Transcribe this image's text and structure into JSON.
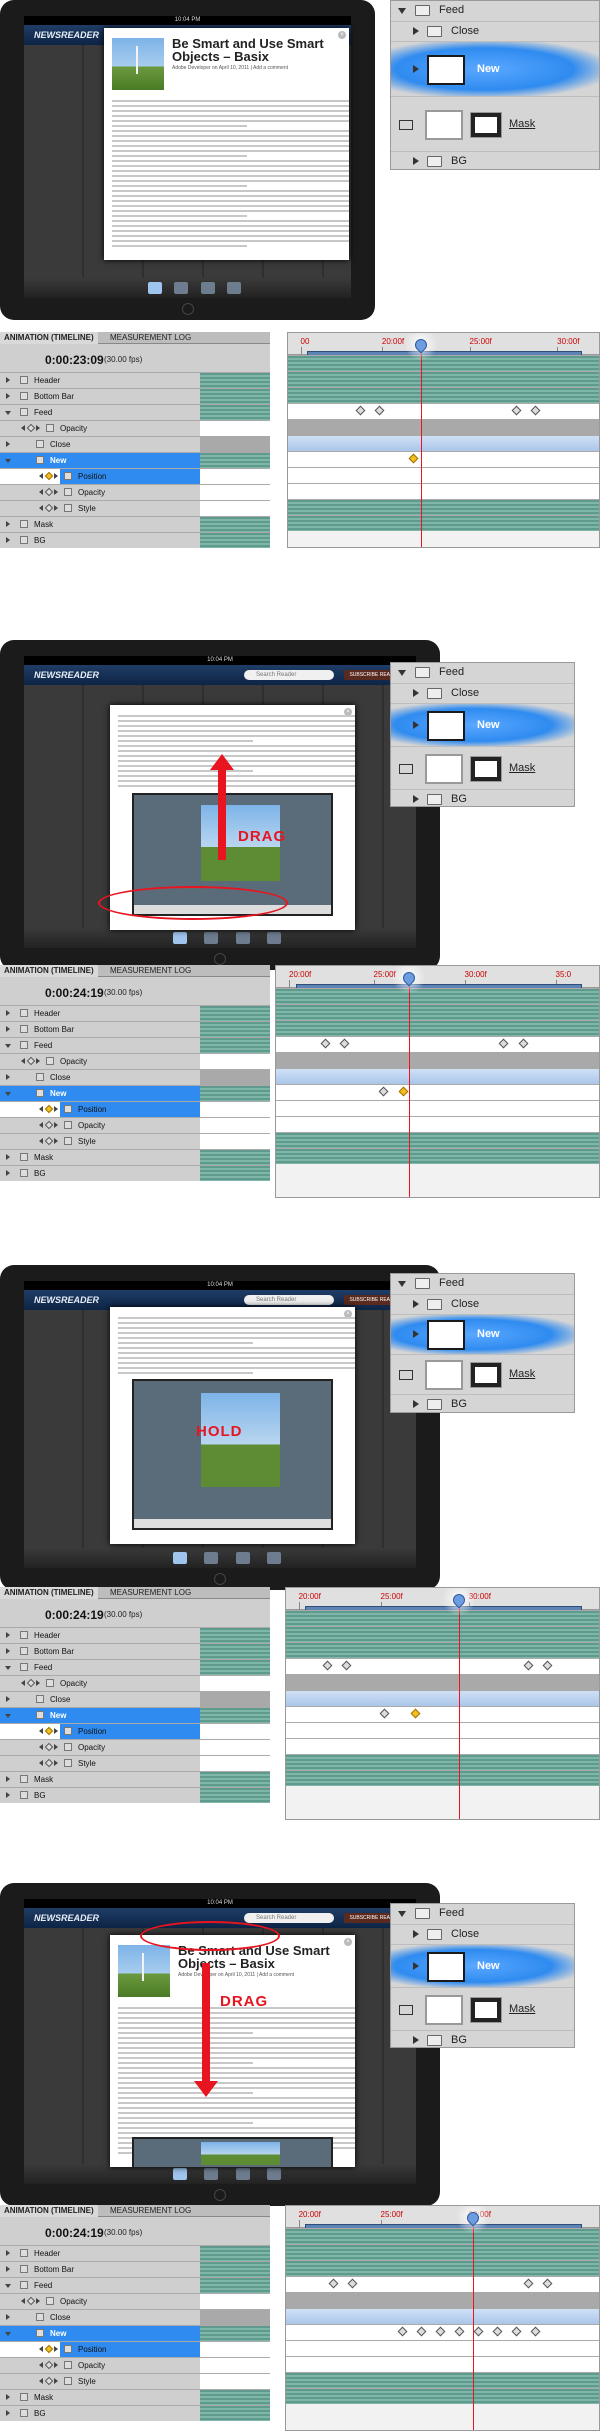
{
  "app": {
    "device_status_left": "iPad",
    "device_time": "10:04 PM",
    "app_name": "NEWSREADER",
    "search_placeholder": "Search Reader",
    "subscribe_label": "SUBSCRIBE READER"
  },
  "article": {
    "title_line1": "Be Smart and Use Smart",
    "title_line2": "Objects – Basix",
    "meta": "Adobe Developer on April 10, 2011 | Add a comment"
  },
  "layers_panel": {
    "group_name": "Feed",
    "items": [
      "Close",
      "New",
      "Mask",
      "BG"
    ]
  },
  "timeline": {
    "tab_animation": "ANIMATION (TIMELINE)",
    "tab_measurement": "MEASUREMENT LOG",
    "fps": "(30.00 fps)",
    "layers": [
      "Header",
      "Bottom Bar",
      "Feed",
      "Opacity",
      "Close",
      "New",
      "Position",
      "Opacity",
      "Style",
      "Mask",
      "BG"
    ]
  },
  "steps": [
    {
      "timecode": "0:00:23:09",
      "ticks": [
        "00",
        "20:00f",
        "25:00f",
        "30:00f"
      ],
      "annotation": ""
    },
    {
      "timecode": "0:00:24:19",
      "ticks": [
        "20:00f",
        "25:00f",
        "30:00f",
        "35:0"
      ],
      "annotation": "DRAG"
    },
    {
      "timecode": "0:00:24:19",
      "ticks": [
        "20:00f",
        "25:00f",
        "30:00f"
      ],
      "annotation": "HOLD"
    },
    {
      "timecode": "0:00:24:19",
      "ticks": [
        "20:00f",
        "25:00f",
        "30:00f"
      ],
      "annotation": "DRAG"
    }
  ]
}
